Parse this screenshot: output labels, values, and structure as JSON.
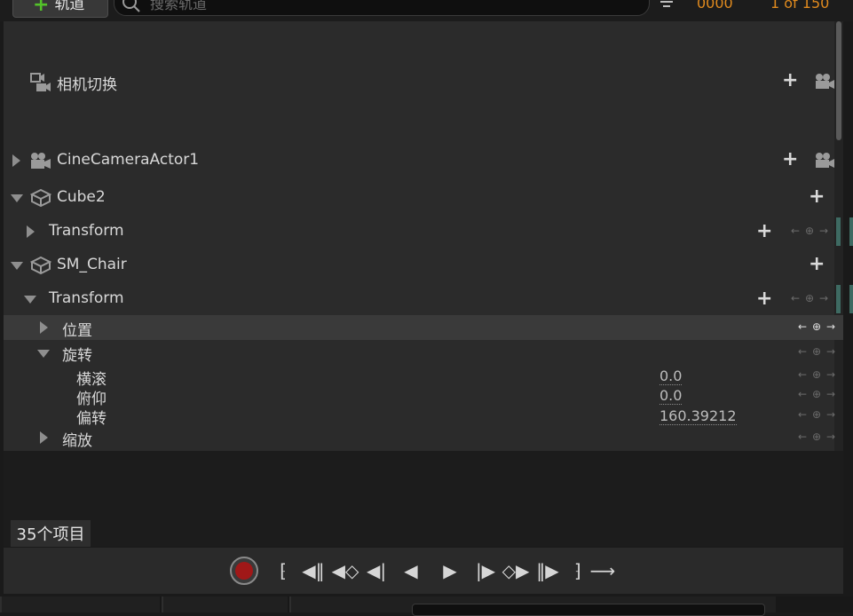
{
  "toolbar": {
    "add_track_label": "轨道",
    "search_placeholder": "搜索轨道",
    "frame_current": "0000",
    "frame_range": "1 of 150"
  },
  "tree": {
    "camera_cut_label": "相机切换",
    "cine_camera_label": "CineCameraActor1",
    "cube_label": "Cube2",
    "cube_transform_label": "Transform",
    "chair_label": "SM_Chair",
    "chair_transform_label": "Transform",
    "location_label": "位置",
    "rotation_label": "旋转",
    "roll_label": "横滚",
    "roll_value": "0.0",
    "pitch_label": "俯仰",
    "pitch_value": "0.0",
    "yaw_label": "偏转",
    "yaw_value": "160.39212",
    "scale_label": "缩放"
  },
  "footer": {
    "item_count": "35个项目"
  },
  "colors": {
    "accent_green": "#53c229",
    "frame_orange": "#e08a1e",
    "record_red": "#a01818"
  },
  "icons": [
    "filter-icon",
    "search-icon",
    "camera-cut-icon",
    "camera-icon",
    "cube-icon",
    "record-icon"
  ]
}
